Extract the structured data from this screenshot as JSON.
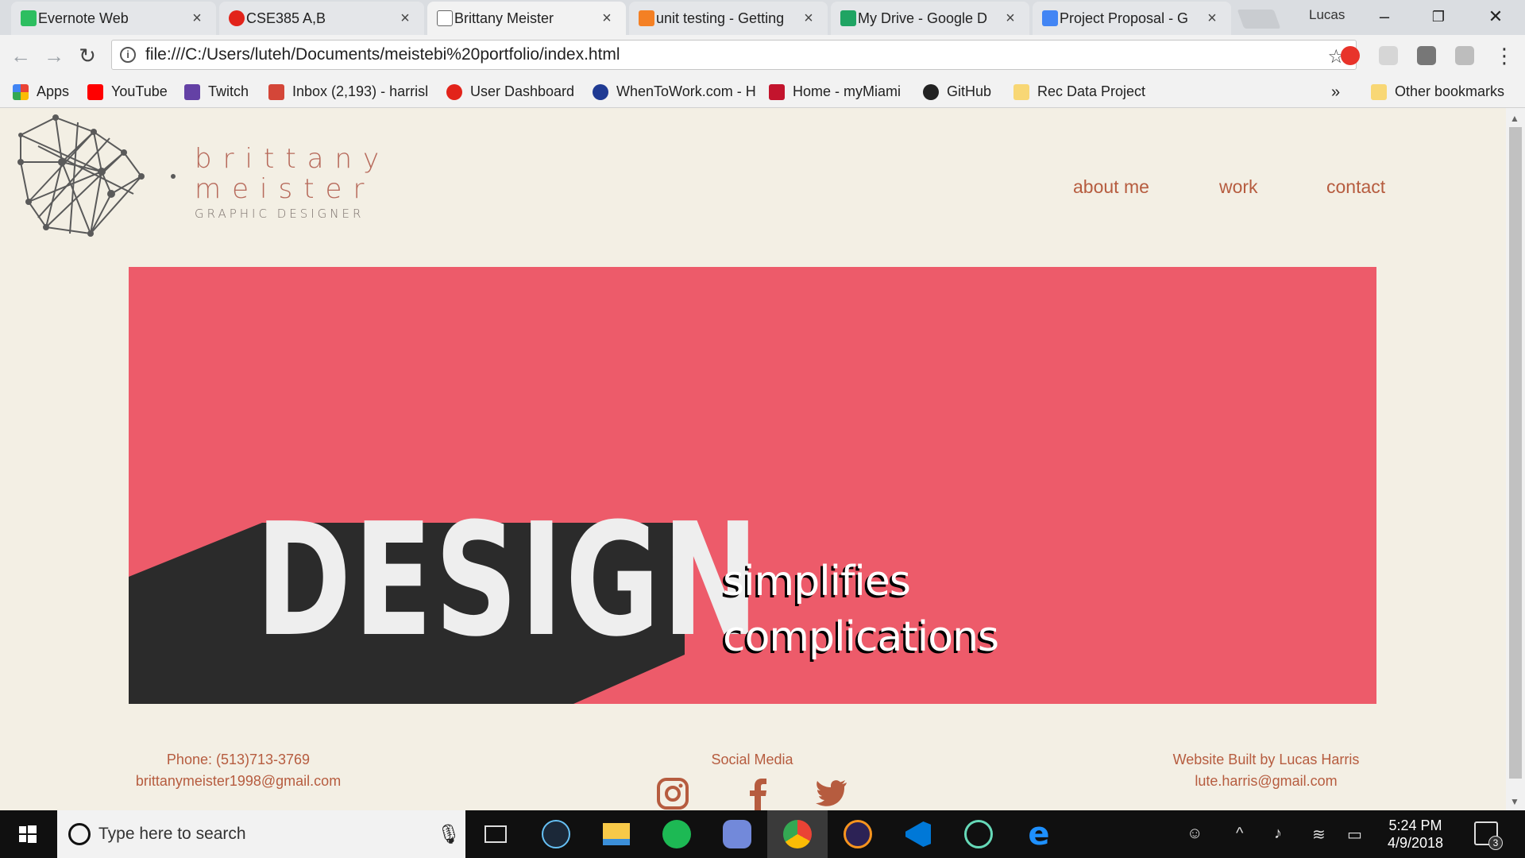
{
  "browser": {
    "tabs": [
      {
        "title": "Evernote Web",
        "color": "#2dbe60"
      },
      {
        "title": "CSE385 A,B",
        "color": "#e2231a"
      },
      {
        "title": "Brittany Meister",
        "color": "#ffffff"
      },
      {
        "title": "unit testing - Getting",
        "color": "#f48024"
      },
      {
        "title": "My Drive - Google D",
        "color": "#1fa463"
      },
      {
        "title": "Project Proposal - G",
        "color": "#4285f4"
      }
    ],
    "profile_name": "Lucas",
    "url": "file:///C:/Users/luteh/Documents/meistebi%20portfolio/index.html",
    "bookmarks": [
      {
        "label": "Apps",
        "color": "#e94235"
      },
      {
        "label": "YouTube",
        "color": "#ff0000"
      },
      {
        "label": "Twitch",
        "color": "#6441a5"
      },
      {
        "label": "Inbox (2,193) - harrisl",
        "color": "#d44638"
      },
      {
        "label": "User Dashboard",
        "color": "#e2231a"
      },
      {
        "label": "WhenToWork.com - H",
        "color": "#1f3a93"
      },
      {
        "label": "Home - myMiami",
        "color": "#c3142d"
      },
      {
        "label": "GitHub",
        "color": "#222222"
      },
      {
        "label": "Rec Data Project",
        "color": "#f8d775"
      }
    ],
    "bookmarks_overflow": "»",
    "other_bookmarks": "Other bookmarks"
  },
  "site": {
    "logo": {
      "first": "brittany",
      "last": "meister",
      "subtitle": "GRAPHIC DESIGNER"
    },
    "nav": [
      "about me",
      "work",
      "contact"
    ],
    "hero": {
      "headline": "DESIGN",
      "line1": "simplifies",
      "line2": "complications"
    },
    "footer": {
      "phone": "Phone: (513)713-3769",
      "email": "brittanymeister1998@gmail.com",
      "social_heading": "Social Media",
      "social_icons": [
        "instagram-icon",
        "facebook-icon",
        "twitter-icon"
      ],
      "credit": "Website Built by Lucas Harris",
      "credit_email": "lute.harris@gmail.com"
    }
  },
  "taskbar": {
    "search_placeholder": "Type here to search",
    "time": "5:24 PM",
    "date": "4/9/2018",
    "notification_count": "3",
    "apps": [
      "task-view",
      "steam",
      "file-explorer",
      "spotify",
      "discord",
      "chrome",
      "eclipse",
      "vscode",
      "atom",
      "edge"
    ]
  },
  "colors": {
    "page_bg": "#f3efe4",
    "hero_bg": "#ed5b6a",
    "accent": "#b65c3f"
  }
}
